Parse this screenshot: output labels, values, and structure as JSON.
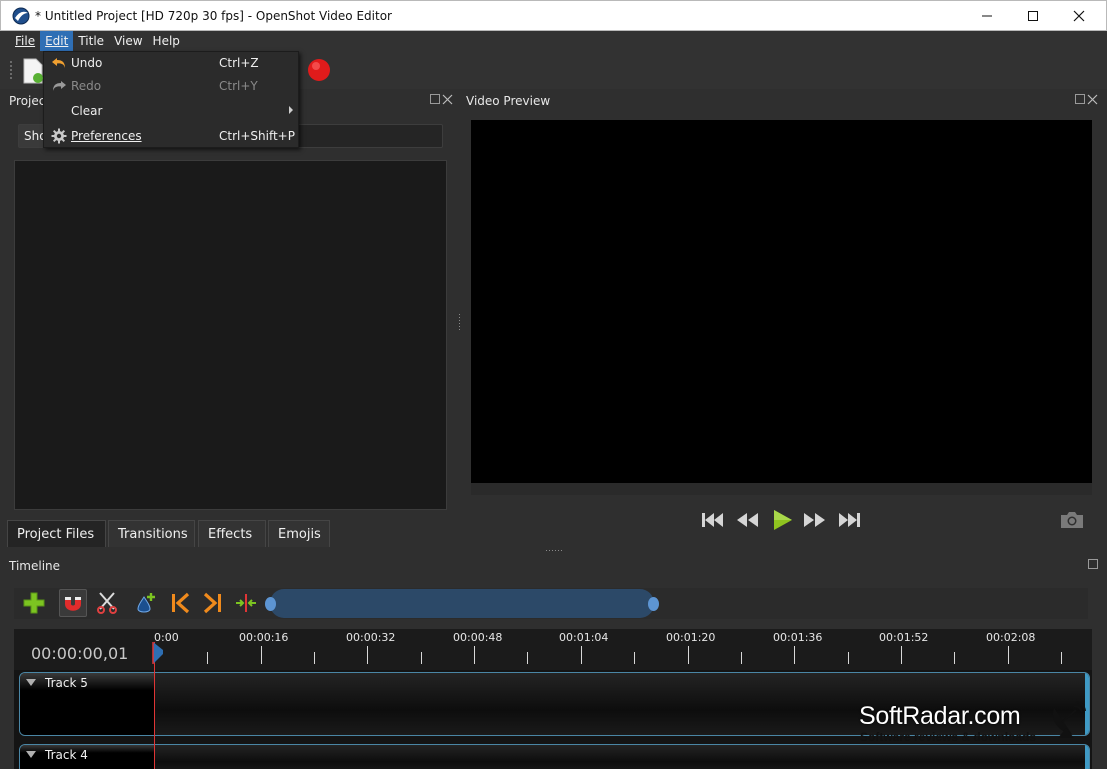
{
  "window": {
    "title": "* Untitled Project [HD 720p 30 fps] - OpenShot Video Editor"
  },
  "menubar": {
    "items": [
      {
        "label": "File",
        "active": false
      },
      {
        "label": "Edit",
        "active": true
      },
      {
        "label": "Title",
        "active": false
      },
      {
        "label": "View",
        "active": false
      },
      {
        "label": "Help",
        "active": false
      }
    ]
  },
  "edit_menu": {
    "items": [
      {
        "label": "Undo",
        "shortcut": "Ctrl+Z",
        "icon": "undo-icon",
        "enabled": true
      },
      {
        "label": "Redo",
        "shortcut": "Ctrl+Y",
        "icon": "redo-icon",
        "enabled": false
      },
      {
        "label": "Clear",
        "shortcut": "",
        "icon": "",
        "enabled": true,
        "submenu": true
      },
      {
        "label": "Preferences",
        "shortcut": "Ctrl+Shift+P",
        "icon": "gear-icon",
        "enabled": true
      }
    ]
  },
  "project_panel": {
    "title": "Project",
    "filter_button": "Sho"
  },
  "panel_tabs": [
    {
      "label": "Project Files",
      "active": true
    },
    {
      "label": "Transitions",
      "active": false
    },
    {
      "label": "Effects",
      "active": false
    },
    {
      "label": "Emojis",
      "active": false
    }
  ],
  "video_preview": {
    "title": "Video Preview"
  },
  "timeline": {
    "title": "Timeline",
    "current_time": "00:00:00,01",
    "tick_labels": [
      "0:00",
      "00:00:16",
      "00:00:32",
      "00:00:48",
      "00:01:04",
      "00:01:20",
      "00:01:36",
      "00:01:52",
      "00:02:08"
    ],
    "tracks": [
      {
        "name": "Track 5"
      },
      {
        "name": "Track 4"
      }
    ]
  },
  "watermark": {
    "title": "SoftRadar.com",
    "subtitle": "Software reviews & downloads"
  },
  "colors": {
    "menu_highlight": "#2f6fb5",
    "playhead": "#e03535",
    "track_border": "#4a86a5",
    "zoom_bar": "#2c4968"
  }
}
